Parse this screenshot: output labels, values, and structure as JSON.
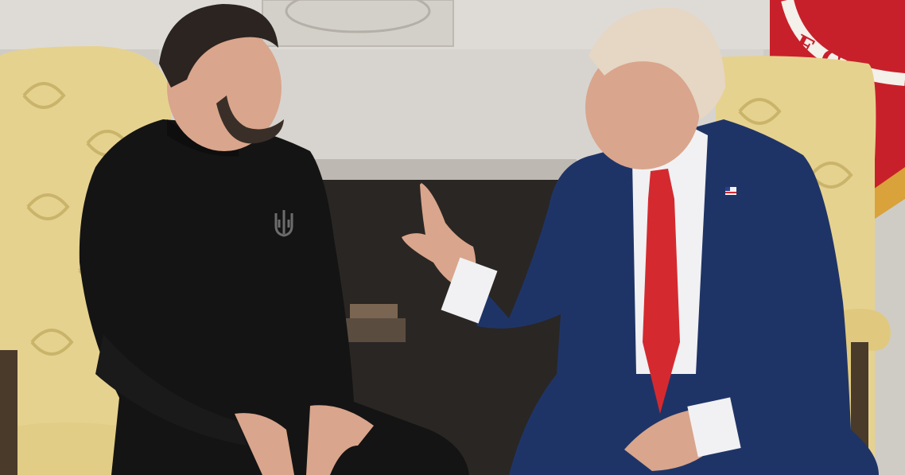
{
  "photo": {
    "flag_lettering": "E CO"
  },
  "colors": {
    "marble": "#d9d6d1",
    "fireplace_interior": "#2a2623",
    "armchair_damask": "#e6d28f",
    "armchair_shadow": "#c9b46a",
    "black_sweater": "#141414",
    "navy_suit": "#1f3466",
    "white_shirt": "#f1f1f3",
    "red_tie": "#d42a2f",
    "skin": "#d9a58c",
    "flag_red": "#c8202a",
    "flag_fringe": "#d9a23a",
    "hair_dark": "#2b2420",
    "hair_light": "#e6d6c4"
  },
  "icons": {
    "trident_emblem": "trident-icon",
    "flag_pin": "flag-pin-icon"
  }
}
